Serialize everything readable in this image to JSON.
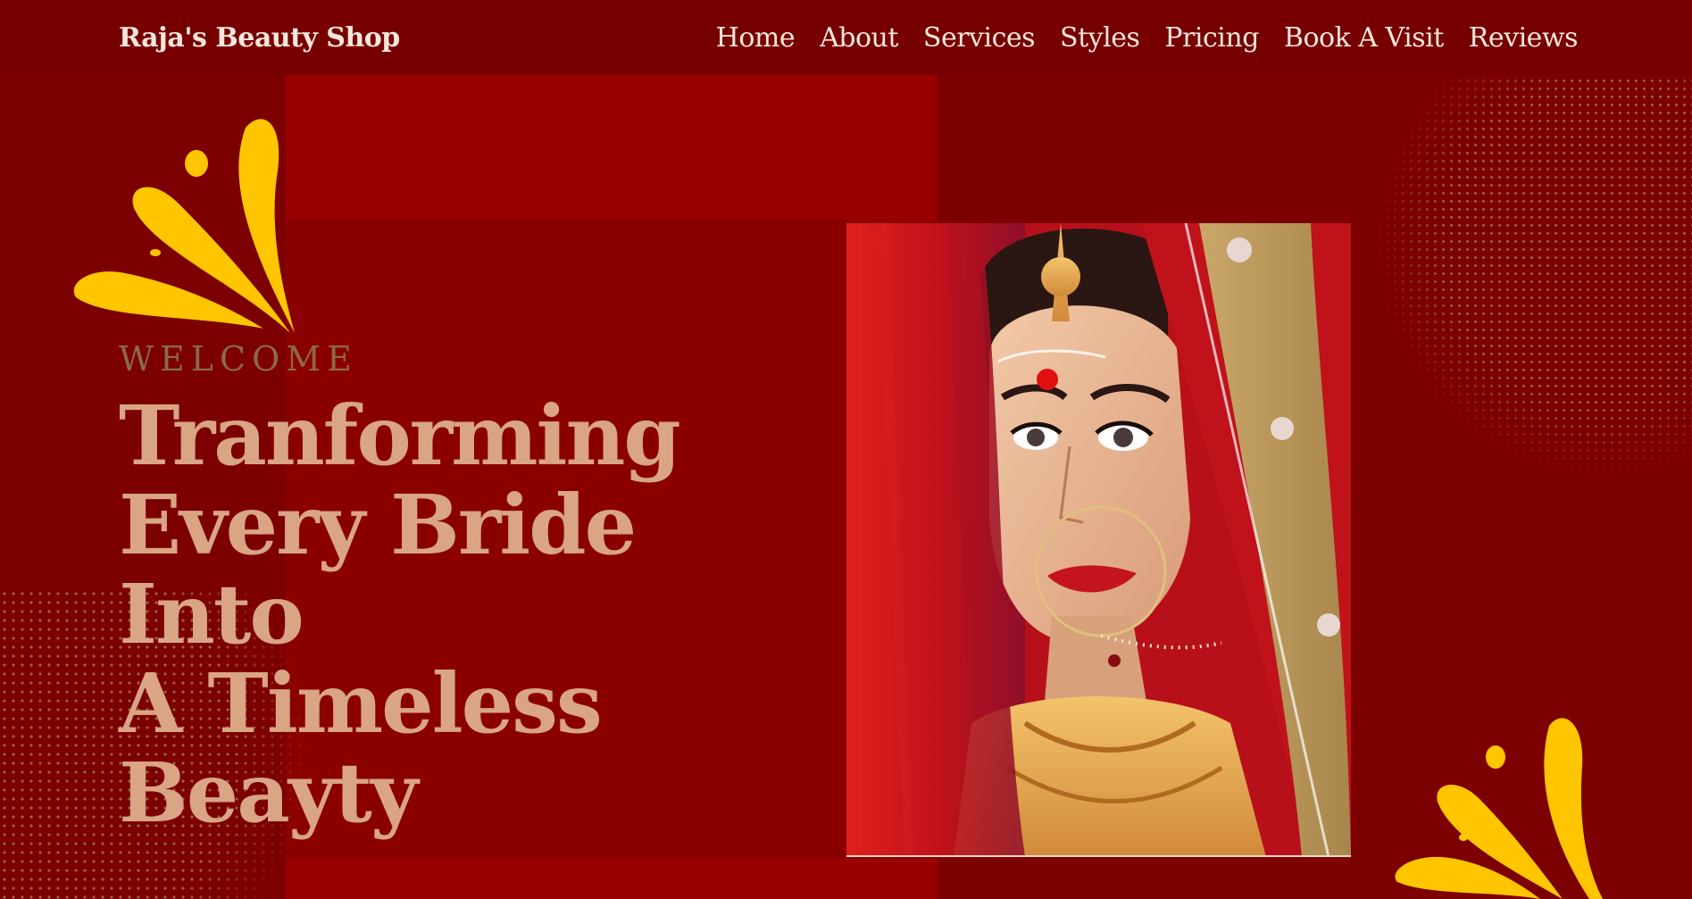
{
  "header": {
    "brand": "Raja's Beauty Shop",
    "nav": [
      "Home",
      "About",
      "Services",
      "Styles",
      "Pricing",
      "Book A Visit",
      "Reviews"
    ]
  },
  "hero": {
    "eyebrow": "WELCOME",
    "headline_lines": [
      "Tranforming",
      "Every Bride Into",
      "A Timeless",
      "Beayty"
    ]
  },
  "colors": {
    "background": "#7d0000",
    "header": "#760000",
    "accent_block": "#990000",
    "headline": "#d9a585",
    "eyebrow": "#8c6a44",
    "petal": "#ffc600"
  },
  "image": {
    "subject": "bride-portrait"
  }
}
